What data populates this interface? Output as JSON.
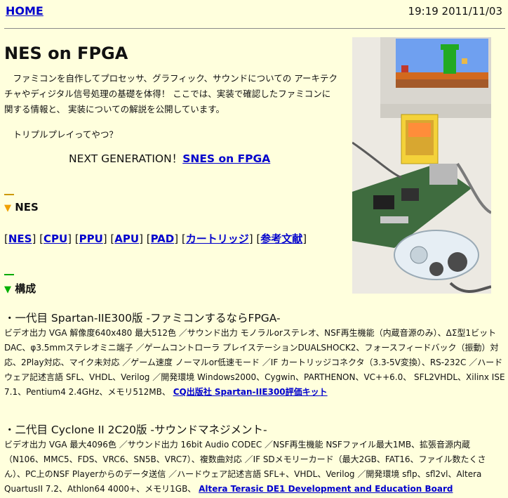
{
  "header": {
    "home_label": "HOME",
    "timestamp": "19:19 2011/11/03"
  },
  "page": {
    "title": "NES on FPGA",
    "intro": "　ファミコンを自作してプロセッサ、グラフィック、サウンドについての アーキテクチャやディジタル信号処理の基礎を体得！ ここでは、実装で確認したファミコンに関する情報と、 実装についての解説を公開しています。",
    "tagline": "トリプルプレイってやつ？",
    "nextgen_prefix": "NEXT GENERATION！",
    "nextgen_link": "SNES on FPGA"
  },
  "sections": {
    "nes_heading": "NES",
    "config_heading": "構成"
  },
  "nav_links": [
    "NES",
    "CPU",
    "PPU",
    "APU",
    "PAD",
    "カートリッジ",
    "参考文献"
  ],
  "generations": [
    {
      "title": "・一代目 Spartan-IIE300版 -ファミコンするならFPGA-",
      "desc": "ビデオ出力 VGA 解像度640x480 最大512色 ／サウンド出力 モノラルorステレオ、NSF再生機能（内蔵音源のみ）、ΔΣ型1ビットDAC、φ3.5mmステレオミニ端子 ／ゲームコントローラ プレイステーションDUALSHOCK2、フォースフィードバック（振動）対応、2Play対応、マイク未対応 ／ゲーム速度 ノーマルor低速モード ／IF カートリッジコネクタ（3.3-5V変換）、RS-232C ／ハードウェア記述言語 SFL、VHDL、Verilog ／開発環境 Windows2000、Cygwin、PARTHENON、VC++6.0、 SFL2VHDL、Xilinx ISE 7.1、Pentium4 2.4GHz、メモリ512MB、 ",
      "link": "CQ出版社 Spartan-IIE300評価キット"
    },
    {
      "title": "・二代目 Cyclone II 2C20版 -サウンドマネジメント-",
      "desc": "ビデオ出力 VGA 最大4096色 ／サウンド出力 16bit Audio CODEC ／NSF再生機能 NSFファイル最大1MB、拡張音源内蔵（N106、MMC5、FDS、VRC6、SN5B、VRC7）、複数曲対応 ／IF SDメモリーカード（最大2GB、FAT16、ファイル数たくさん）、PC上のNSF Playerからのデータ送信 ／ハードウェア記述言語 SFL+、VHDL、Verilog ／開発環境 sflp、sfl2vl、Altera QuartusII 7.2、Athlon64 4000+、メモリ1GB、 ",
      "link": "Altera Terasic DE1 Development and Education Board"
    }
  ],
  "colors": {
    "background": "#ffffdd",
    "link": "#0000cc",
    "orange_triangle": "#f0a000",
    "green_triangle": "#00b000"
  }
}
